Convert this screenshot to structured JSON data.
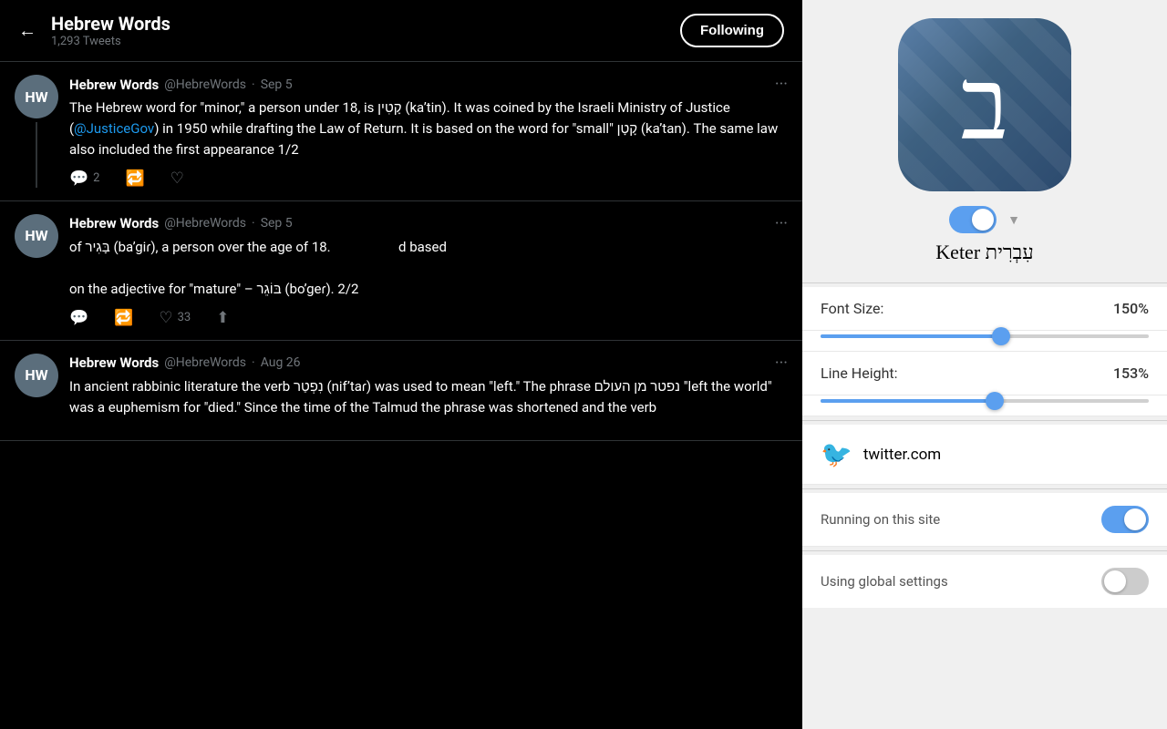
{
  "header": {
    "back_label": "←",
    "profile_name": "Hebrew Words",
    "profile_tweets": "1,293 Tweets",
    "following_label": "Following"
  },
  "tweets": [
    {
      "id": "tweet-1",
      "author": "Hebrew Words",
      "handle": "@HebreWords",
      "date": "Sep 5",
      "text_part1": "The Hebrew word for \"minor,\" a person under 18, is קָטִין (kaʼtin). It was coined by the Israeli Ministry of Justice (",
      "mention": "@JusticeGov",
      "text_part2": ") in 1950 while drafting the Law of Return. It is based on the word for \"small\" קָטָן (kaʼtan). The same law also included the first appearance 1/2",
      "reply_count": "2",
      "retweet_count": "",
      "like_count": "",
      "share_count": "",
      "has_thread": true
    },
    {
      "id": "tweet-2",
      "author": "Hebrew Words",
      "handle": "@HebreWords",
      "date": "Sep 5",
      "text_line1": "of בָּגִיר (baʼgiɾ), a person over the age of 18.",
      "text_line2": "d based",
      "text_line3": "on the adjective for \"mature\" – בּוֹגֵר (boʼgeɾ). 2/2",
      "reply_count": "",
      "retweet_count": "",
      "like_count": "33",
      "share_count": "",
      "has_thread": false
    },
    {
      "id": "tweet-3",
      "author": "Hebrew Words",
      "handle": "@HebreWords",
      "date": "Aug 26",
      "text": "In ancient rabbinic literature the verb נִפְטַר (nifʼtaɾ) was used to mean \"left.\" The phrase נפטר מן העולם \"left the world\" was a euphemism for \"died.\" Since the time of the Talmud the phrase was shortened and the verb",
      "reply_count": "",
      "retweet_count": "",
      "like_count": "",
      "share_count": "",
      "has_thread": false
    }
  ],
  "avatar": {
    "initials": "HW"
  },
  "extension": {
    "hebrew_letter": "ב",
    "font_name": "עִבְרִית Keter",
    "font_size_label": "Font Size:",
    "font_size_value": "150%",
    "font_size_percent": 55,
    "line_height_label": "Line Height:",
    "line_height_value": "153%",
    "line_height_percent": 53,
    "site_name": "twitter.com",
    "running_label": "Running on this site",
    "global_label": "Using global settings"
  },
  "icons": {
    "reply": "🗨",
    "retweet": "🔁",
    "like": "♡",
    "share": "↑",
    "dots": "···",
    "twitter_bird": "🐦"
  }
}
